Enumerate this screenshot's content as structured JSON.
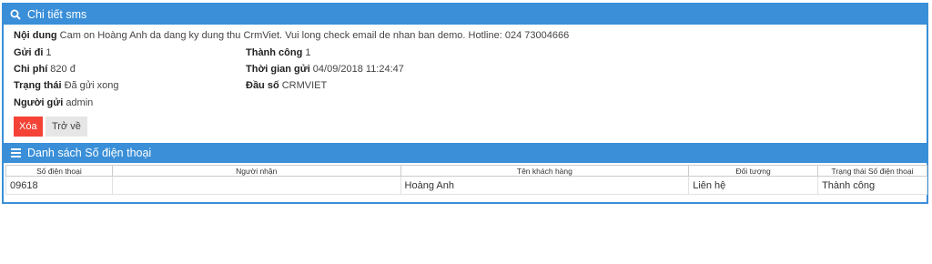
{
  "detail_panel": {
    "title": "Chi tiết sms",
    "content_label": "Nội dung",
    "content_value": "Cam on Hoàng Anh da dang ky dung thu CrmViet. Vui long check email de nhan ban demo. Hotline: 024 73004666",
    "sent_label": "Gửi đi",
    "sent_value": "1",
    "success_label": "Thành công",
    "success_value": "1",
    "cost_label": "Chi phí",
    "cost_value": "820 đ",
    "send_time_label": "Thời gian gửi",
    "send_time_value": "04/09/2018 11:24:47",
    "status_label": "Trạng thái",
    "status_value": "Đã gửi xong",
    "prefix_label": "Đầu số",
    "prefix_value": "CRMVIET",
    "sender_label": "Người gửi",
    "sender_value": "admin",
    "delete_button": "Xóa",
    "back_button": "Trở về"
  },
  "phone_list": {
    "title": "Danh sách Số điện thoại",
    "columns": [
      "Số điện thoại",
      "Người nhận",
      "Tên khách hàng",
      "Đối tượng",
      "Trạng thái Số điện thoại"
    ],
    "rows": [
      [
        "09618",
        "",
        "Hoàng Anh",
        "Liên hệ",
        "Thành công"
      ]
    ]
  },
  "colors": {
    "header_blue": "#3a8fd8",
    "delete_red": "#f44336"
  },
  "icons": {
    "detail_header": "search-icon",
    "list_header": "list-icon"
  }
}
